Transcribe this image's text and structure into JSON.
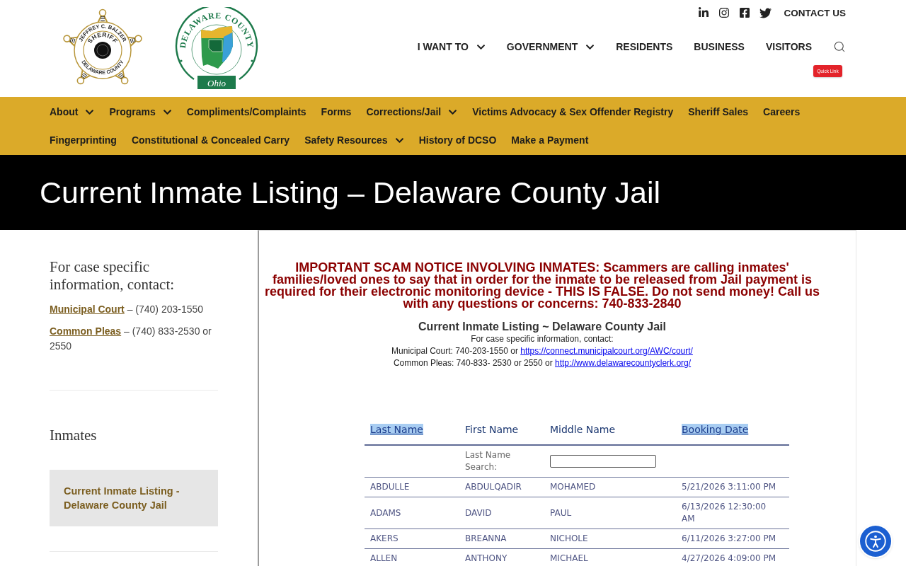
{
  "header": {
    "badge_logo": {
      "top_text": "JEFFREY C. BALZER",
      "title": "SHERIFF",
      "bottom_text": "DELAWARE COUNTY"
    },
    "seal_logo": {
      "ring_text": "DELAWARE COUNTY",
      "banner": "Ohio"
    },
    "contact_link": "CONTACT US",
    "main_nav": [
      {
        "label": "I WANT TO",
        "has_dropdown": true
      },
      {
        "label": "GOVERNMENT",
        "has_dropdown": true
      },
      {
        "label": "RESIDENTS",
        "has_dropdown": false
      },
      {
        "label": "BUSINESS",
        "has_dropdown": false
      },
      {
        "label": "VISITORS",
        "has_dropdown": false
      }
    ],
    "quick_link": "Quick Link"
  },
  "section_nav": [
    {
      "label": "About",
      "has_dropdown": true
    },
    {
      "label": "Programs",
      "has_dropdown": true
    },
    {
      "label": "Compliments/Complaints",
      "has_dropdown": false
    },
    {
      "label": "Forms",
      "has_dropdown": false
    },
    {
      "label": "Corrections/Jail",
      "has_dropdown": true
    },
    {
      "label": "Victims Advocacy & Sex Offender Registry",
      "has_dropdown": false
    },
    {
      "label": "Sheriff Sales",
      "has_dropdown": false
    },
    {
      "label": "Careers",
      "has_dropdown": false
    },
    {
      "label": "Fingerprinting",
      "has_dropdown": false
    },
    {
      "label": "Constitutional & Concealed Carry",
      "has_dropdown": false
    },
    {
      "label": "Safety Resources",
      "has_dropdown": true
    },
    {
      "label": "History of DCSO",
      "has_dropdown": false
    },
    {
      "label": "Make a Payment",
      "has_dropdown": false
    }
  ],
  "page_title": "Current Inmate Listing – Delaware County Jail",
  "sidebar": {
    "contact_heading": "For case specific information, contact:",
    "contacts": [
      {
        "link": "Municipal Court",
        "detail": "– (740) 203-1550"
      },
      {
        "link": "Common Pleas",
        "detail": "– (740) 833-2530 or 2550"
      }
    ],
    "section_heading": "Inmates",
    "items": [
      {
        "label": "Current Inmate Listing - Delaware County Jail",
        "selected": true
      }
    ]
  },
  "listing": {
    "notice": "IMPORTANT SCAM NOTICE INVOLVING INMATES: Scammers are calling inmates' families/loved ones to say that in order for the inmate to be released from Jail payment is required for their electronic monitoring device - THIS IS FALSE. Do not send money! Call us with any questions or concerns: 740-833-2840",
    "title": "Current Inmate Listing ~ Delaware County Jail",
    "subtitle": "For case specific information, contact:",
    "contacts": [
      {
        "text": "Municipal Court: 740-203-1550 or",
        "link": "https://connect.municipalcourt.org/AWC/court/"
      },
      {
        "text": "Common Pleas: 740-833- 2530 or 2550 or",
        "link": "http://www.delawarecountyclerk.org/"
      }
    ],
    "table": {
      "columns": [
        {
          "label": "Last Name",
          "sortable": true
        },
        {
          "label": "First Name",
          "sortable": false
        },
        {
          "label": "Middle Name",
          "sortable": false
        },
        {
          "label": "Booking Date",
          "sortable": true
        }
      ],
      "search_label": "Last Name Search:",
      "rows": [
        [
          "ABDULLE",
          "ABDULQADIR",
          "MOHAMED",
          "5/21/2026 3:11:00 PM"
        ],
        [
          "ADAMS",
          "DAVID",
          "PAUL",
          "6/13/2026 12:30:00 AM"
        ],
        [
          "AKERS",
          "BREANNA",
          "NICHOLE",
          "6/11/2026 3:27:00 PM"
        ],
        [
          "ALLEN",
          "ANTHONY",
          "MICHAEL",
          "4/27/2026 4:09:00 PM"
        ]
      ]
    }
  }
}
